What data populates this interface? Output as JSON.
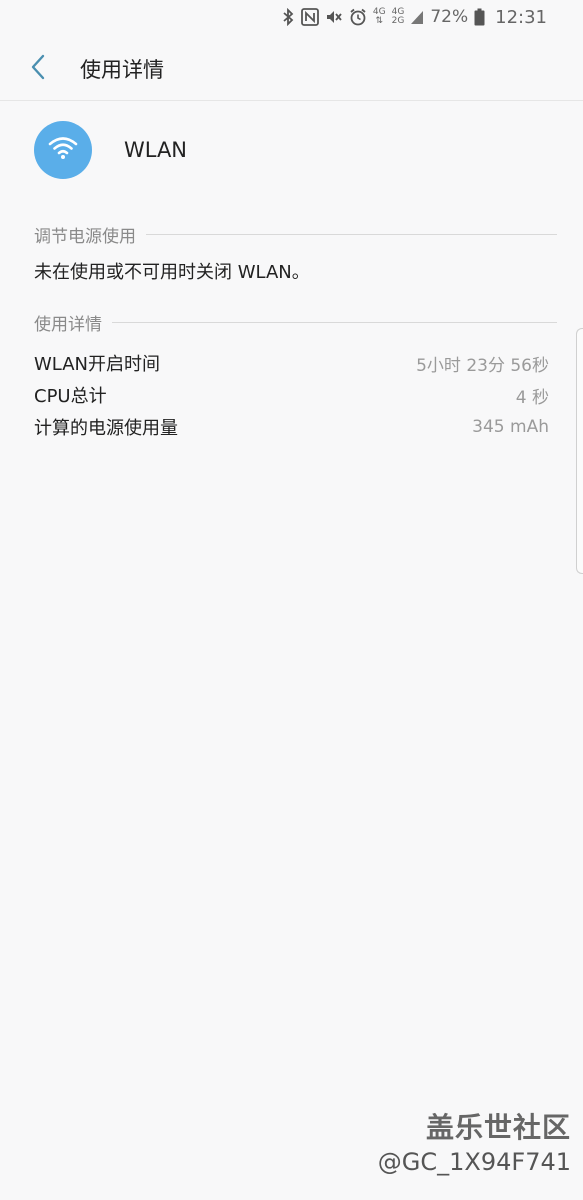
{
  "status_bar": {
    "net1_top": "4G",
    "net1_bottom": "⇅",
    "net2_top": "4G",
    "net2_bottom": "2G",
    "battery_text": "72%",
    "time": "12:31"
  },
  "app_bar": {
    "title": "使用详情"
  },
  "app": {
    "name": "WLAN"
  },
  "adjust_section": {
    "header": "调节电源使用",
    "text": "未在使用或不可用时关闭 WLAN。"
  },
  "details_section": {
    "header": "使用详情",
    "rows": [
      {
        "label": "WLAN开启时间",
        "value": "5小时 23分 56秒"
      },
      {
        "label": "CPU总计",
        "value": "4 秒"
      },
      {
        "label": "计算的电源使用量",
        "value": "345 mAh"
      }
    ]
  },
  "watermark": {
    "brand": "盖乐世社区",
    "user": "@GC_1X94F741"
  },
  "colors": {
    "accent": "#5aaee9",
    "back_arrow": "#4a8fb0",
    "background": "#f8f8f9"
  },
  "icons": {
    "back": "chevron-left-icon",
    "wifi": "wifi-icon",
    "bluetooth": "bluetooth-icon",
    "nfc": "nfc-icon",
    "mute": "mute-icon",
    "alarm": "alarm-icon",
    "signal": "signal-icon",
    "battery": "battery-icon"
  }
}
